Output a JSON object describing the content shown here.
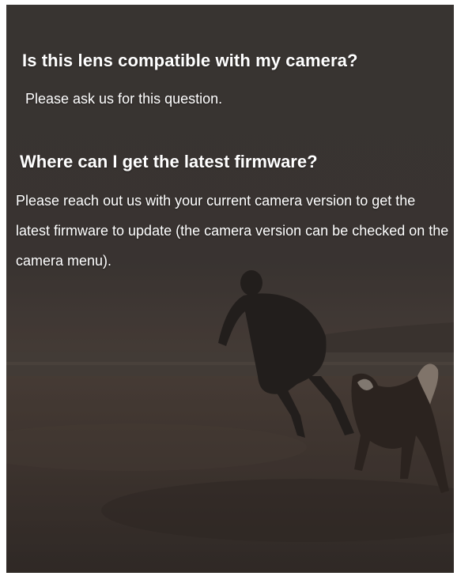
{
  "faq": {
    "items": [
      {
        "question": "Is this lens compatible with my camera?",
        "answer": "Please ask us for this question."
      },
      {
        "question": "Where can I get the latest firmware?",
        "answer": "Please reach out us with your current camera version to get the latest firmware to update (the camera version can be checked on the camera menu)."
      }
    ]
  },
  "background": {
    "description_icon": "beach-scene-image",
    "overlay_color": "#2f2b29",
    "text_color": "#ffffff"
  }
}
